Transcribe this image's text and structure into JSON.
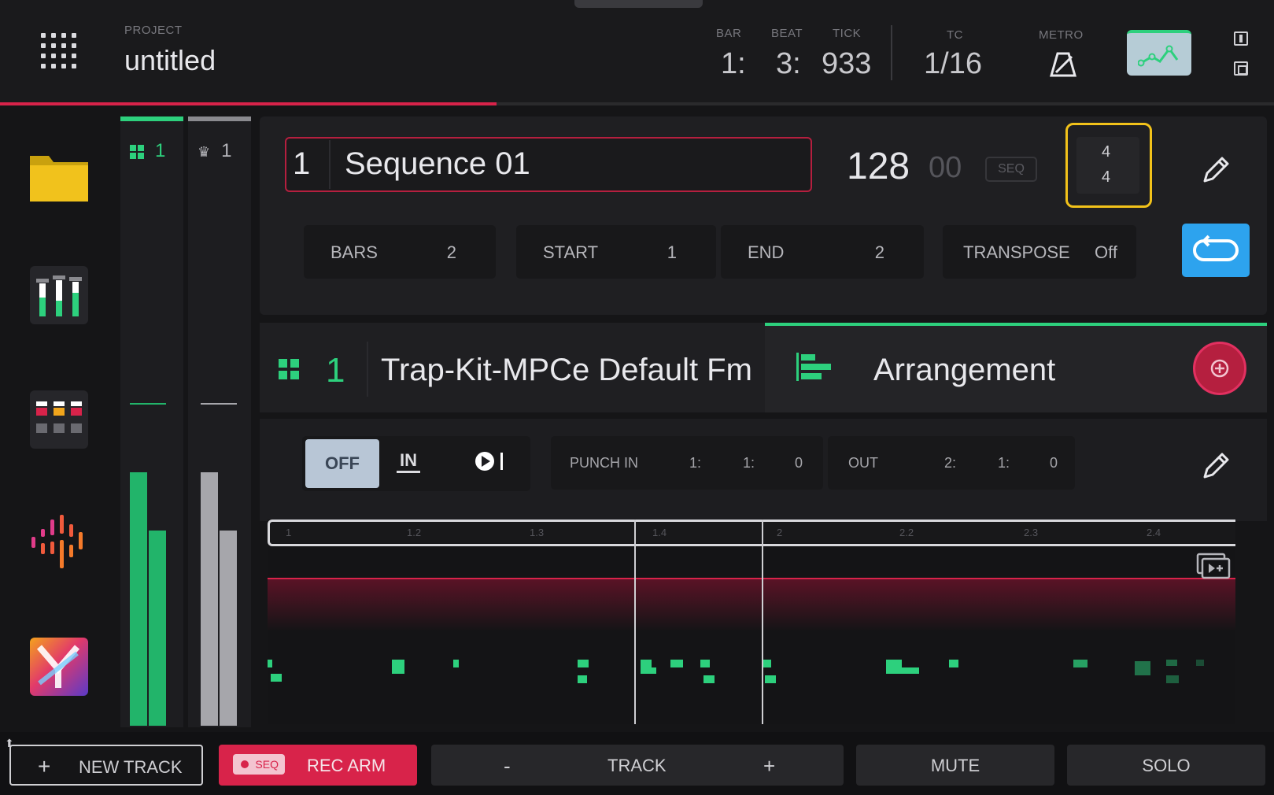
{
  "header": {
    "project_label": "PROJECT",
    "project_name": "untitled",
    "bar_label": "BAR",
    "beat_label": "BEAT",
    "tick_label": "TICK",
    "bar_value": "1:",
    "beat_value": "3:",
    "tick_value": "933",
    "tc_label": "TC",
    "tc_value": "1/16",
    "metro_label": "METRO",
    "playback_progress_percent": 39
  },
  "meters": {
    "col1_label": "1",
    "col2_label": "1"
  },
  "sequence": {
    "number": "1",
    "name": "Sequence 01",
    "bpm": "128",
    "bpm_decimal": "00",
    "bpm_source": "SEQ",
    "timesig_num": "4",
    "timesig_den": "4",
    "params": {
      "bars_label": "BARS",
      "bars_value": "2",
      "start_label": "START",
      "start_value": "1",
      "end_label": "END",
      "end_value": "2",
      "transpose_label": "TRANSPOSE",
      "transpose_value": "Off"
    }
  },
  "track": {
    "number": "1",
    "name": "Trap-Kit-MPCe Default Fm",
    "tab_label": "Arrangement"
  },
  "record": {
    "mode_off": "OFF",
    "mode_in": "IN",
    "punch_in_label": "PUNCH IN",
    "punch_in_bar": "1:",
    "punch_in_beat": "1:",
    "punch_in_tick": "0",
    "out_label": "OUT",
    "out_bar": "2:",
    "out_beat": "1:",
    "out_tick": "0"
  },
  "timeline": {
    "ticks": [
      "1",
      "1.2",
      "1.3",
      "1.4",
      "2",
      "2.2",
      "2.3",
      "2.4"
    ]
  },
  "bottom": {
    "new_track": "NEW TRACK",
    "seq_badge": "SEQ",
    "rec_arm": "REC ARM",
    "track_minus": "-",
    "track": "TRACK",
    "track_plus": "+",
    "mute": "MUTE",
    "solo": "SOLO"
  },
  "colors": {
    "accent_green": "#2dd07d",
    "accent_red": "#d8234a",
    "highlight_yellow": "#f2c21a",
    "loop_blue": "#2da3ee"
  }
}
